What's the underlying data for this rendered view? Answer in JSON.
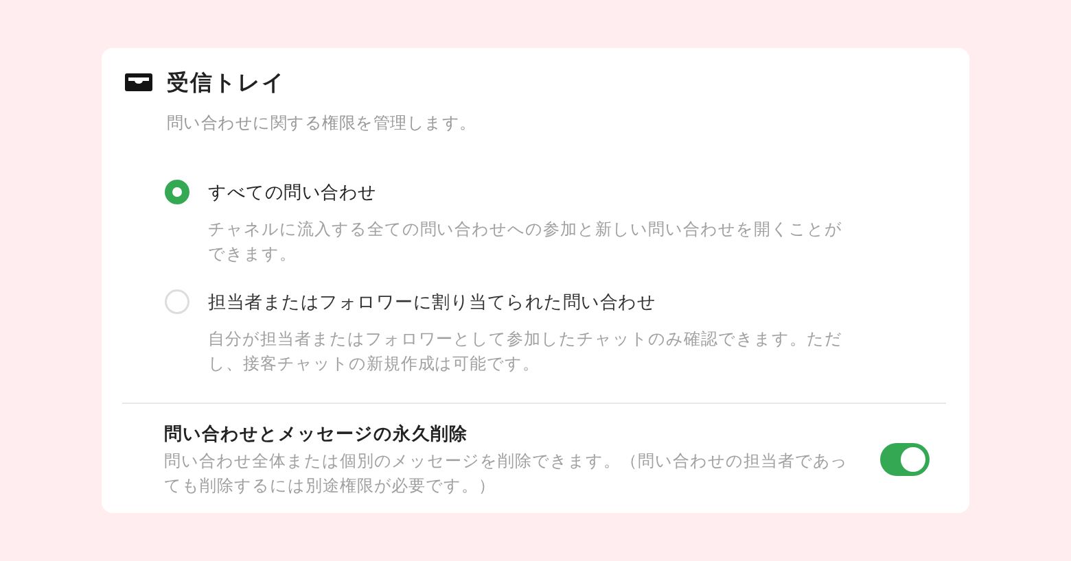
{
  "header": {
    "title": "受信トレイ",
    "description": "問い合わせに関する権限を管理します。"
  },
  "options": [
    {
      "label": "すべての問い合わせ",
      "description": "チャネルに流入する全ての問い合わせへの参加と新しい問い合わせを開くことができます。",
      "selected": true
    },
    {
      "label": "担当者またはフォロワーに割り当てられた問い合わせ",
      "description": "自分が担当者またはフォロワーとして参加したチャットのみ確認できます。ただし、接客チャットの新規作成は可能です。",
      "selected": false
    }
  ],
  "permissions": [
    {
      "title": "問い合わせとメッセージの永久削除",
      "description": "問い合わせ全体または個別のメッセージを削除できます。（問い合わせの担当者であっても削除するには別途権限が必要です。）",
      "on": true
    }
  ]
}
